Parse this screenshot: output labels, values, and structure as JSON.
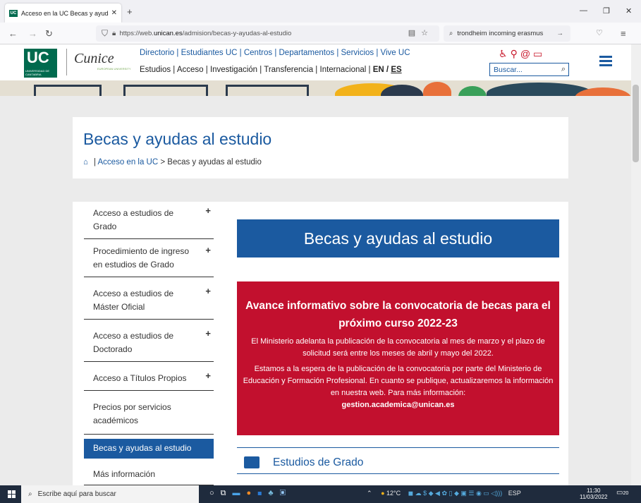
{
  "browser": {
    "tab_title": "Acceso en la UC Becas y ayuda",
    "tab_favicon": "UC",
    "url_prefix": "https://web.",
    "url_domain": "unican.es",
    "url_path": "/admision/becas-y-ayudas-al-estudio",
    "search_text": "trondheim incoming erasmus"
  },
  "header": {
    "logo_big": "UC",
    "logo_small": "UNIVERSIDAD DE CANTABRIA",
    "cunice": "Cunice",
    "cunice_sub": "EUROPEAN UNIVERSITY",
    "nav_row1": "Directorio | Estudiantes UC | Centros | Departamentos | Servicios | Vive UC",
    "nav_row2": "Estudios | Acceso | Investigación | Transferencia | Internacional |",
    "lang_en": "EN",
    "lang_sep": " / ",
    "lang_es": "ES",
    "search_placeholder": "Buscar...",
    "colors": {
      "brand_blue": "#1b5aa0",
      "uc_green": "#006a4e",
      "alert_red": "#c2102e"
    }
  },
  "title_card": {
    "title": "Becas y ayudas al estudio",
    "breadcrumb_sep": "|",
    "breadcrumb_link": "Acceso en la UC",
    "breadcrumb_rest": " > Becas y ayudas al estudio"
  },
  "sidebar": {
    "items": [
      {
        "label": "Acceso a estudios de Grado",
        "plus": "+"
      },
      {
        "label": "Procedimiento de ingreso en estudios de Grado",
        "plus": "+"
      },
      {
        "label": "Acceso a estudios de Máster Oficial",
        "plus": "+"
      },
      {
        "label": "Acceso a estudios de Doctorado",
        "plus": "+"
      },
      {
        "label": "Acceso a Títulos Propios",
        "plus": "+"
      },
      {
        "label": "Precios por servicios académicos"
      },
      {
        "label": "Becas y ayudas al estudio"
      },
      {
        "label": "Más información"
      }
    ]
  },
  "content": {
    "banner_title": "Becas y ayudas al estudio",
    "alert_title": "Avance informativo sobre la convocatoria de becas para el próximo curso 2022-23",
    "alert_p1": "El Ministerio adelanta la publicación de la convocatoria al mes de marzo y el plazo de solicitud será entre los meses de abril y mayo del 2022.",
    "alert_p2": "Estamos a la espera de la publicación de la convocatoria por parte del Ministerio de Educación y Formación Profesional. En cuanto se publique, actualizaremos la información en nuestra web. Para más información:",
    "alert_email": "gestion.academica@unican.es",
    "section_title": "Estudios de Grado"
  },
  "taskbar": {
    "search_placeholder": "Escribe aquí para buscar",
    "weather": "12°C",
    "lang": "ESP",
    "time": "11:30",
    "date": "11/03/2022",
    "notif_count": "20"
  }
}
